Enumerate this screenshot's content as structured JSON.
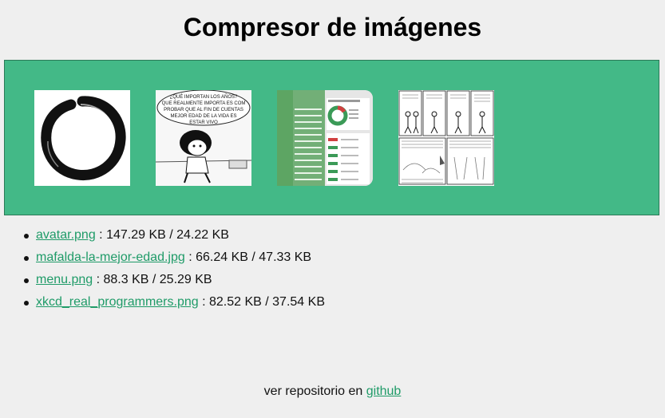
{
  "title": "Compresor de imágenes",
  "colors": {
    "dropzone": "#43b987",
    "link": "#1f9b68",
    "background": "#efefef"
  },
  "thumbnails": [
    {
      "name": "avatar-thumbnail",
      "alt": "avatar.png"
    },
    {
      "name": "mafalda-thumbnail",
      "alt": "mafalda-la-mejor-edad.jpg",
      "caption": "¿QUÉ IMPORTAN LOS AÑOS? LO QUE REALMENTE IMPORTA ES COMPROBAR QUE AL FIN DE CUENTAS LA MEJOR EDAD DE LA VIDA ES ESTAR VIVO"
    },
    {
      "name": "menu-thumbnail",
      "alt": "menu.png"
    },
    {
      "name": "xkcd-thumbnail",
      "alt": "xkcd_real_programmers.png"
    }
  ],
  "files": [
    {
      "name": "avatar.png",
      "sizes": " : 147.29 KB / 24.22 KB"
    },
    {
      "name": "mafalda-la-mejor-edad.jpg",
      "sizes": " : 66.24 KB / 47.33 KB"
    },
    {
      "name": "menu.png",
      "sizes": " : 88.3 KB / 25.29 KB"
    },
    {
      "name": "xkcd_real_programmers.png",
      "sizes": " : 82.52 KB / 37.54 KB"
    }
  ],
  "footer": {
    "text": "ver repositorio en ",
    "link": "github"
  }
}
